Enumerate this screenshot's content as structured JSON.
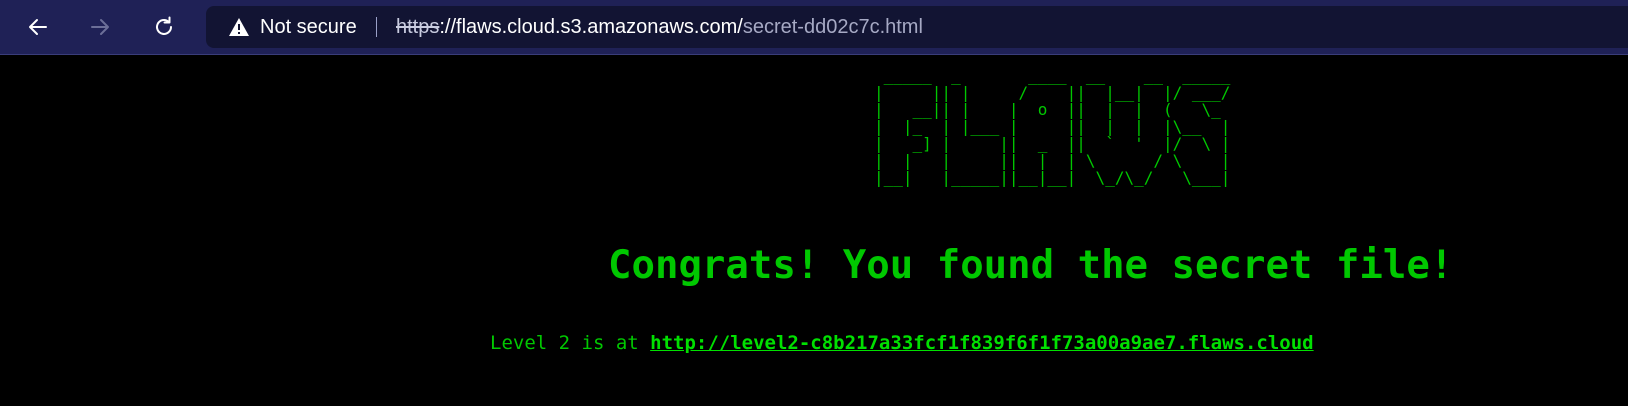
{
  "browser": {
    "security_label": "Not secure",
    "url_scheme": "https",
    "url_host_rest": "://flaws.cloud.s3.amazonaws.com/",
    "url_path": "secret-dd02c7c.html",
    "icons": {
      "back": "back-arrow-icon",
      "forward": "forward-arrow-icon",
      "reload": "reload-icon",
      "warning": "warning-triangle-icon"
    }
  },
  "page": {
    "ascii_logo": " _____  _       ____  __    __  _____\n|     || |     /    ||  |__|  |/ ___/\n|   __|| |    |  o  ||  |  |  (   \\_ \n|  |_  | |___ |     ||  |  |  |\\__  |\n|   _] |     ||  _  ||  `  '  |/  \\ |\n|  |   |     ||  |  | \\      / \\    |\n|__|   |_____||__|__|  \\_/\\_/   \\___|",
    "headline": "Congrats! You found the secret file!",
    "level_prefix": "Level 2 is at ",
    "level_link": "http://level2-c8b217a33fcf1f839f6f1f73a00a9ae7.flaws.cloud"
  },
  "colors": {
    "toolbar": "#1f2156",
    "omnibox": "#121433",
    "page_bg": "#000000",
    "terminal_green": "#00c800"
  }
}
